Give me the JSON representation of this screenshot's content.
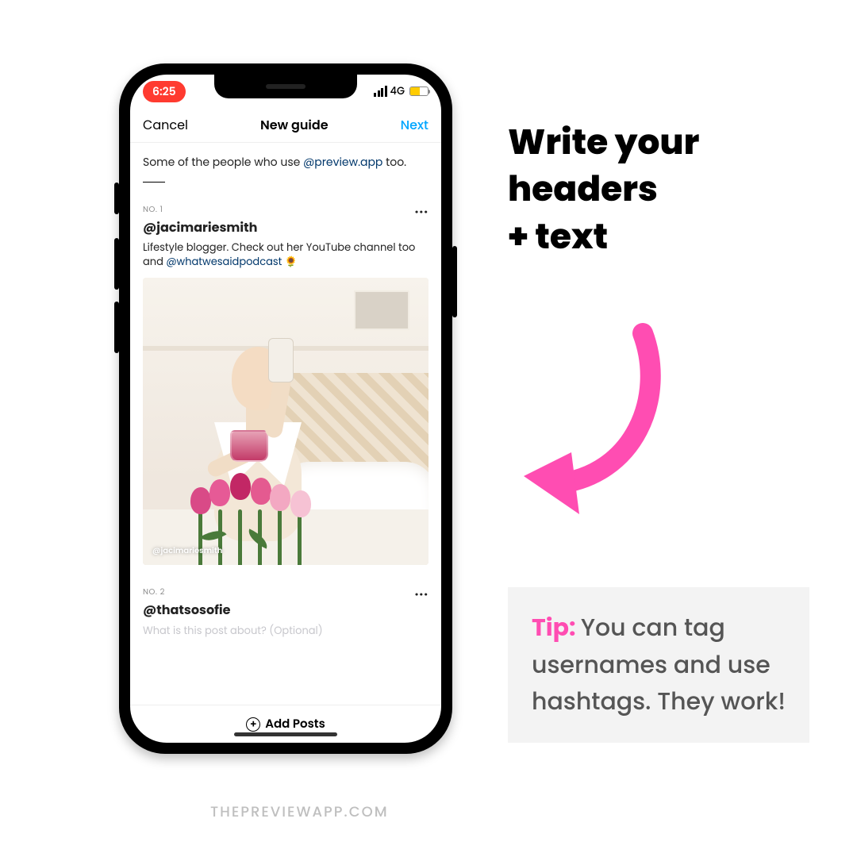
{
  "status": {
    "time": "6:25",
    "network": "4G"
  },
  "nav": {
    "cancel": "Cancel",
    "title": "New guide",
    "next": "Next"
  },
  "intro": {
    "prefix": "Some of the people who use ",
    "mention": "@preview.app",
    "suffix": " too."
  },
  "sections": [
    {
      "no_label": "NO. 1",
      "handle": "@jacimariesmith",
      "desc_prefix": "Lifestyle blogger. Check out her YouTube channel too and ",
      "desc_mention": "@whatwesaidpodcast",
      "desc_suffix": " 🌻",
      "image_credit": "@jacimariesmith"
    },
    {
      "no_label": "NO. 2",
      "handle": "@thatsosofie",
      "placeholder": "What is this post about? (Optional)"
    }
  ],
  "bottom": {
    "add_posts": "Add Posts"
  },
  "headline": {
    "line1": "Write your",
    "line2": "headers",
    "line3": "+ text"
  },
  "tip": {
    "label": "Tip: ",
    "text": "You can tag usernames and use hashtags. They work!"
  },
  "watermark": "THEPREVIEWAPP.COM",
  "colors": {
    "pink": "#ff4db2",
    "link": "#00376b",
    "next": "#00a6ff"
  }
}
